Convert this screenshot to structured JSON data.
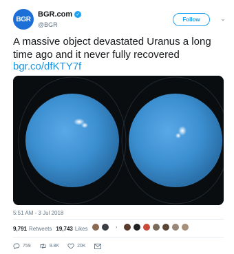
{
  "author": {
    "avatar_text": "BGR",
    "display_name": "BGR.com",
    "handle": "@BGR"
  },
  "follow_label": "Follow",
  "tweet": {
    "text": "A massive object devastated Uranus a long time ago and it never fully recovered",
    "link": "bgr.co/dfKTY7f"
  },
  "timestamp": "5:51 AM - 3 Jul 2018",
  "stats": {
    "retweets_count": "9,791",
    "retweets_label": "Retweets",
    "likes_count": "19,743",
    "likes_label": "Likes"
  },
  "actions": {
    "replies": "759",
    "retweets": "9.8K",
    "likes": "20K"
  },
  "colors": {
    "accent": "#1da1f2",
    "link": "#1b95e0",
    "planet": "#3b8fd0"
  },
  "icons": {
    "verified": "verified-badge-icon",
    "menu": "chevron-down-icon",
    "reply": "reply-icon",
    "retweet": "retweet-icon",
    "like": "heart-icon"
  }
}
